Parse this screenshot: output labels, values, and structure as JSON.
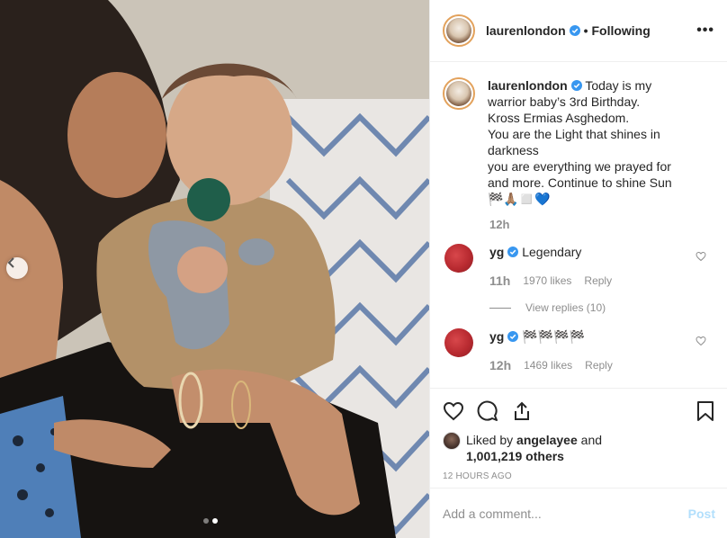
{
  "post": {
    "username": "laurenlondon",
    "follow_state": "Following",
    "more_label": "•••",
    "separator": "•"
  },
  "caption": {
    "username": "laurenlondon",
    "text_lines": [
      "Today is my",
      "warrior baby’s 3rd Birthday.",
      "Kross Ermias Asghedom.",
      "You are the Light that shines in",
      "darkness",
      "you are everything we prayed for",
      "and more. Continue to shine Sun",
      "🏁🙏🏽◻️💙"
    ],
    "time": "12h"
  },
  "comments": [
    {
      "username": "yg",
      "text": "Legendary",
      "time": "11h",
      "likes": "1970 likes",
      "reply": "Reply",
      "view_replies": "View replies (10)"
    },
    {
      "username": "yg",
      "text": "🏁🏁🏁🏁",
      "time": "12h",
      "likes": "1469 likes",
      "reply": "Reply"
    }
  ],
  "likes": {
    "prefix": "Liked by",
    "liker": "angelayee",
    "joiner": "and",
    "others": "1,001,219 others"
  },
  "timestamp": "12 HOURS AGO",
  "add_comment": {
    "placeholder": "Add a comment...",
    "post_label": "Post"
  },
  "carousel": {
    "slides": 2,
    "active_slide": 2
  },
  "colors": {
    "verified": "#3897f0",
    "post_disabled": "#b2dffc",
    "muted": "#8e8e8e"
  },
  "icons": [
    "verified-badge-icon",
    "heart-icon",
    "comment-icon",
    "share-icon",
    "bookmark-icon",
    "chevron-left-icon",
    "more-icon"
  ]
}
